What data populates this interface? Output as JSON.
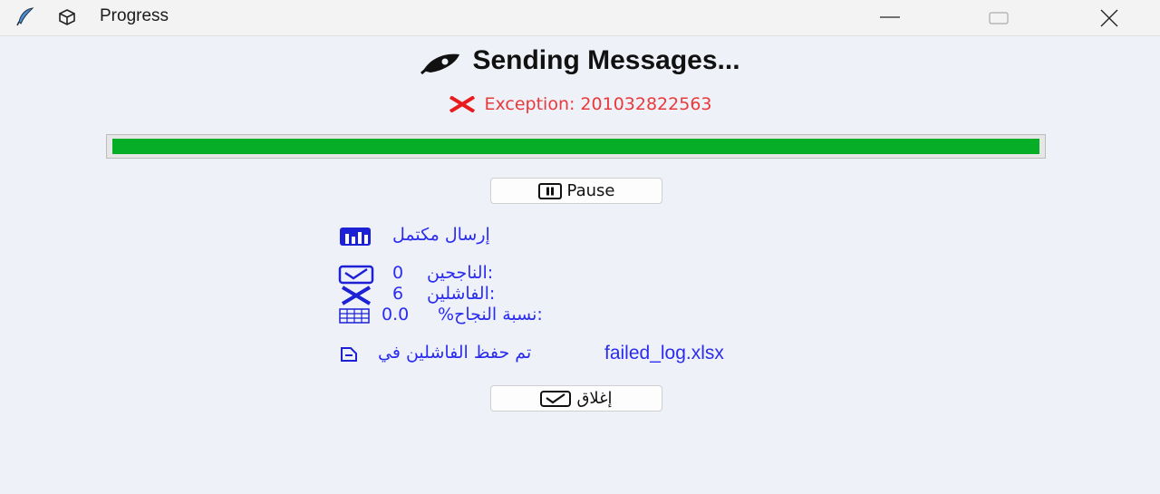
{
  "window": {
    "title": "Progress"
  },
  "header": {
    "title": "Sending Messages..."
  },
  "error": {
    "text": "Exception: 201032822563"
  },
  "progress": {
    "fraction": 1.0
  },
  "buttons": {
    "pause": "Pause",
    "close": "إغلاق"
  },
  "stats": {
    "status": "إرسال مكتمل",
    "successful_label": "الناجحين:",
    "successful_value": "0",
    "failed_label": "الفاشلين:",
    "failed_value": "6",
    "rate_label": "%نسبة النجاح:",
    "rate_value": "0.0",
    "saved_text": "تم حفظ الفاشلين في",
    "saved_file": "failed_log.xlsx"
  },
  "colors": {
    "accent": "#2a2cf0",
    "error": "#e83a3a",
    "progress": "#06ad27"
  }
}
